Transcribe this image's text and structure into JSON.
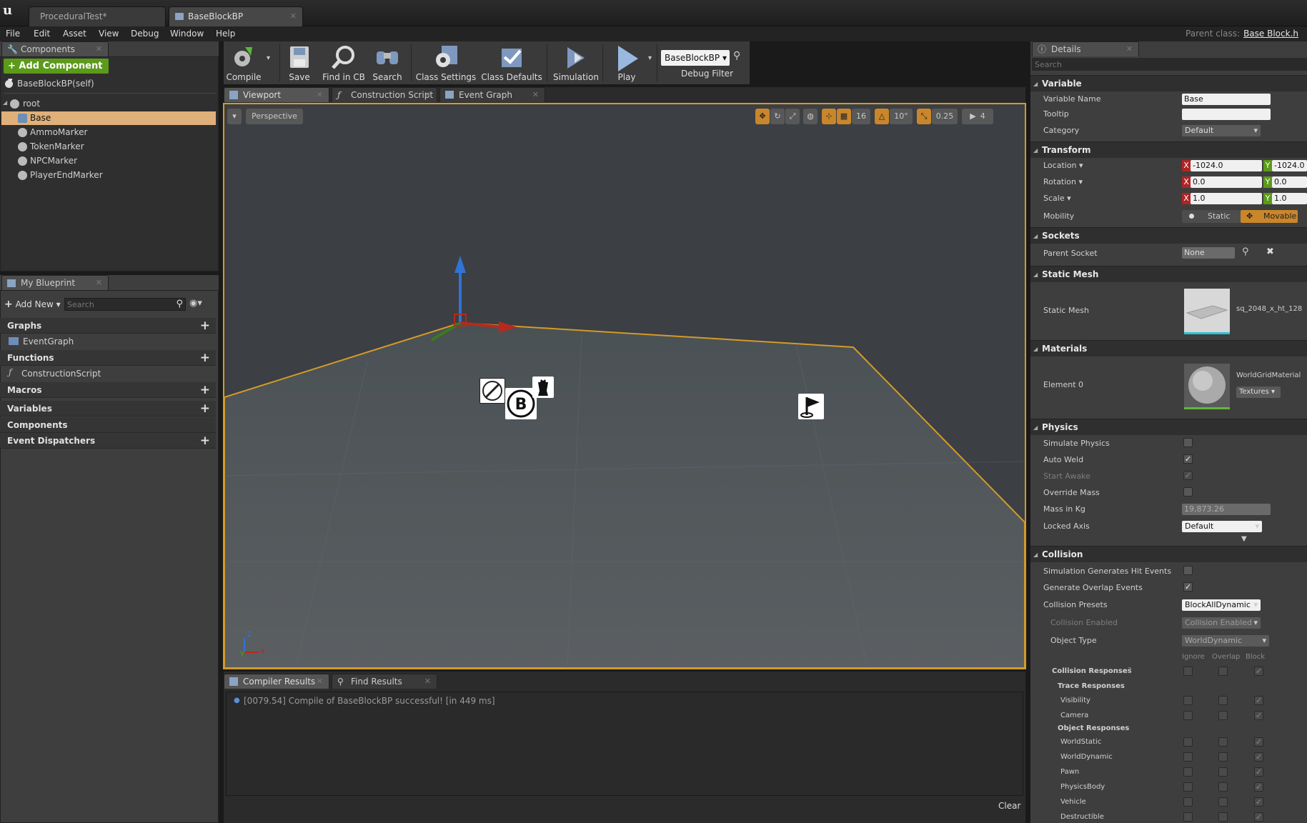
{
  "title_bar": {
    "logo": "unreal-logo-icon",
    "tabs": [
      {
        "label": "ProceduralTest*",
        "active": false
      },
      {
        "label": "BaseBlockBP",
        "active": true
      }
    ]
  },
  "menu": [
    "File",
    "Edit",
    "Asset",
    "View",
    "Debug",
    "Window",
    "Help"
  ],
  "parent_class": {
    "label": "Parent class:",
    "value": "Base Block.h"
  },
  "components_panel": {
    "tab": "Components",
    "add_button": "+ Add Component ▾",
    "self_item": "BaseBlockBP(self)",
    "tree": [
      {
        "label": "root",
        "level": 0,
        "selected": false
      },
      {
        "label": "Base",
        "level": 1,
        "selected": true
      },
      {
        "label": "AmmoMarker",
        "level": 1,
        "selected": false
      },
      {
        "label": "TokenMarker",
        "level": 1,
        "selected": false
      },
      {
        "label": "NPCMarker",
        "level": 1,
        "selected": false
      },
      {
        "label": "PlayerEndMarker",
        "level": 1,
        "selected": false
      }
    ]
  },
  "my_blueprint": {
    "tab": "My Blueprint",
    "add_new": "Add New ▾",
    "search_placeholder": "Search",
    "sections": [
      {
        "label": "Graphs",
        "plus": true,
        "children": [
          "EventGraph"
        ]
      },
      {
        "label": "Functions",
        "plus": true,
        "children": [
          "ConstructionScript"
        ]
      },
      {
        "label": "Macros",
        "plus": true,
        "children": []
      },
      {
        "label": "Variables",
        "plus": true,
        "children": []
      },
      {
        "label": "Components",
        "plus": false,
        "children": []
      },
      {
        "label": "Event Dispatchers",
        "plus": true,
        "children": []
      }
    ]
  },
  "toolbar": {
    "buttons": [
      "Compile",
      "Save",
      "Find in CB",
      "Search",
      "Class Settings",
      "Class Defaults",
      "Simulation",
      "Play"
    ],
    "debug_object": "BaseBlockBP ▾",
    "debug_filter": "Debug Filter"
  },
  "editor_tabs": [
    "Viewport",
    "Construction Script",
    "Event Graph"
  ],
  "viewport": {
    "perspective": "Perspective",
    "grid_snap": "16",
    "rotation_snap": "10°",
    "scale_snap": "0.25",
    "camera_speed": "4",
    "axis_labels": {
      "z": "Z",
      "y": "Y",
      "x": "X"
    },
    "accent": "#d49a2a"
  },
  "bottom_tabs": [
    "Compiler Results",
    "Find Results"
  ],
  "compiler_log": "[0079.54] Compile of BaseBlockBP successful! [in 449 ms]",
  "clear_button": "Clear",
  "details": {
    "tab": "Details",
    "search_placeholder": "Search",
    "variable": {
      "header": "Variable",
      "name_label": "Variable Name",
      "name_value": "Base",
      "tooltip_label": "Tooltip",
      "tooltip_value": "",
      "category_label": "Category",
      "category_value": "Default"
    },
    "transform": {
      "header": "Transform",
      "location_label": "Location ▾",
      "location": {
        "x": "-1024.0",
        "y": "-1024.0"
      },
      "rotation_label": "Rotation ▾",
      "rotation": {
        "x": "0.0",
        "y": "0.0"
      },
      "scale_label": "Scale ▾",
      "scale": {
        "x": "1.0",
        "y": "1.0"
      },
      "mobility_label": "Mobility",
      "mobility_static": "Static",
      "mobility_movable": "Movable",
      "axis_x": "X",
      "axis_y": "Y"
    },
    "sockets": {
      "header": "Sockets",
      "parent_socket_label": "Parent Socket",
      "parent_socket_value": "None"
    },
    "static_mesh": {
      "header": "Static Mesh",
      "label": "Static Mesh",
      "value": "sq_2048_x_ht_128"
    },
    "materials": {
      "header": "Materials",
      "label": "Element 0",
      "value": "WorldGridMaterial",
      "textures": "Textures ▾"
    },
    "physics": {
      "header": "Physics",
      "rows": [
        {
          "label": "Simulate Physics",
          "checked": false,
          "dim": false
        },
        {
          "label": "Auto Weld",
          "checked": true,
          "dim": false
        },
        {
          "label": "Start Awake",
          "checked": true,
          "dim": true
        },
        {
          "label": "Override Mass",
          "checked": false,
          "dim": false
        }
      ],
      "mass_label": "Mass in Kg",
      "mass_value": "19,873.26",
      "locked_axis_label": "Locked Axis",
      "locked_axis_value": "Default"
    },
    "collision": {
      "header": "Collision",
      "sim_hit_label": "Simulation Generates Hit Events",
      "sim_hit": false,
      "overlap_label": "Generate Overlap Events",
      "overlap": true,
      "presets_label": "Collision Presets",
      "presets_value": "BlockAllDynamic",
      "enabled_label": "Collision Enabled",
      "enabled_value": "Collision Enabled",
      "object_type_label": "Object Type",
      "object_type_value": "WorldDynamic",
      "col_headers": [
        "Ignore",
        "Overlap",
        "Block"
      ],
      "responses_label": "Collision Responses",
      "trace_label": "Trace Responses",
      "trace_rows": [
        "Visibility",
        "Camera"
      ],
      "object_label": "Object Responses",
      "object_rows": [
        "WorldStatic",
        "WorldDynamic",
        "Pawn",
        "PhysicsBody",
        "Vehicle",
        "Destructible"
      ]
    }
  }
}
